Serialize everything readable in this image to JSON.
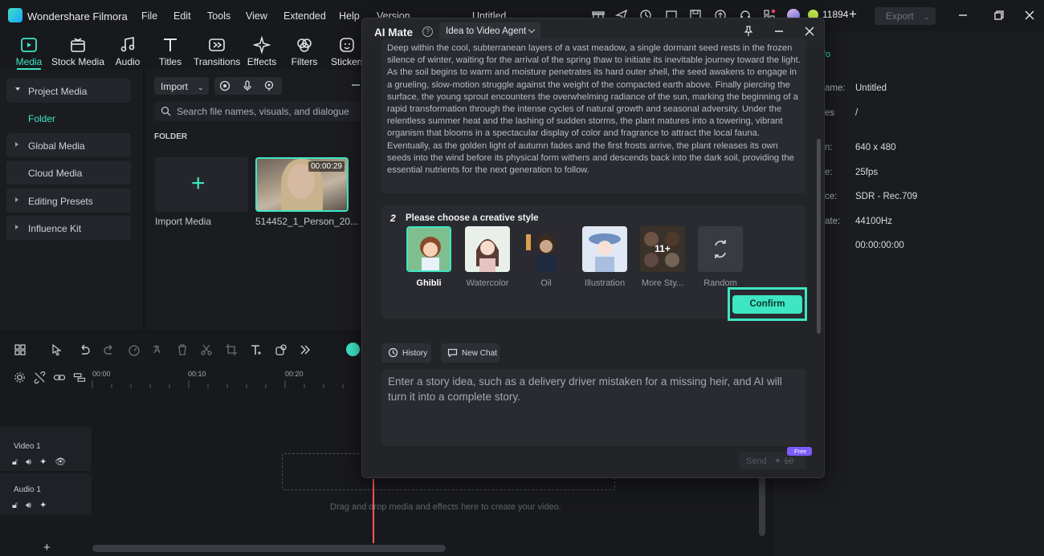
{
  "titlebar": {
    "app_name": "Wondershare Filmora",
    "menus": [
      "File",
      "Edit",
      "Tools",
      "View",
      "Extended",
      "Help",
      "Version"
    ],
    "project_title": "Untitled",
    "credits": "11894",
    "export_label": "Export"
  },
  "toolbar": {
    "tabs": [
      "Media",
      "Stock Media",
      "Audio",
      "Titles",
      "Transitions",
      "Effects",
      "Filters",
      "Stickers"
    ]
  },
  "sidebar": {
    "project_media": "Project Media",
    "folder": "Folder",
    "global_media": "Global Media",
    "cloud_media": "Cloud Media",
    "editing_presets": "Editing Presets",
    "influence_kit": "Influence Kit"
  },
  "media": {
    "import_label": "Import",
    "search_placeholder": "Search file names, visuals, and dialogue",
    "folder_label": "FOLDER",
    "import_media_label": "Import Media",
    "clip_name": "514452_1_Person_20...",
    "clip_duration": "00:00:29"
  },
  "timeline": {
    "ticks": [
      "00:00",
      "00:10",
      "00:20"
    ],
    "video_track": "Video 1",
    "audio_track": "Audio 1",
    "drop_hint": "Drag and drop media and effects here to create your video."
  },
  "info": {
    "tab": "fo",
    "rows": [
      {
        "key": "ame:",
        "value": "Untitled"
      },
      {
        "key": "es",
        "value": "/"
      },
      {
        "key": "n:",
        "value": "640 x 480"
      },
      {
        "key": "e:",
        "value": "25fps"
      },
      {
        "key": "ce:",
        "value": "SDR - Rec.709"
      },
      {
        "key": "ate:",
        "value": "44100Hz"
      },
      {
        "key": "",
        "value": "00:00:00:00"
      }
    ]
  },
  "ai_mate": {
    "title": "AI Mate",
    "agent": "Idea to Video Agent",
    "story": "Deep within the cool, subterranean layers of a vast meadow, a single dormant seed rests in the frozen silence of winter, waiting for the arrival of the spring thaw to initiate its inevitable journey toward the light. As the soil begins to warm and moisture penetrates its hard outer shell, the seed awakens to engage in a grueling, slow-motion struggle against the weight of the compacted earth above. Finally piercing the surface, the young sprout encounters the overwhelming radiance of the sun, marking the beginning of a rapid transformation through the intense cycles of natural growth and seasonal adversity. Under the relentless summer heat and the lashing of sudden storms, the plant matures into a towering, vibrant organism that blooms in a spectacular display of color and fragrance to attract the local fauna. Eventually, as the golden light of autumn fades and the first frosts arrive, the plant releases its own seeds into the wind before its physical form withers and descends back into the dark soil, providing the essential nutrients for the next generation to follow.",
    "step_number": "2",
    "step_title": "Please choose a creative style",
    "styles": [
      "Ghibli",
      "Watercolor",
      "Oil",
      "Illustration",
      "More Sty...",
      "Random"
    ],
    "more_count": "11+",
    "confirm_label": "Confirm",
    "history_label": "History",
    "new_chat_label": "New Chat",
    "prompt_placeholder": "Enter a story idea, such as a delivery driver mistaken for a missing heir, and AI will turn it into a complete story.",
    "send_label": "Send",
    "send_cost": "10",
    "free_badge": "Free"
  },
  "colors": {
    "accent": "#3ee6c4",
    "background": "#141519",
    "playhead": "#ff5a5a"
  }
}
